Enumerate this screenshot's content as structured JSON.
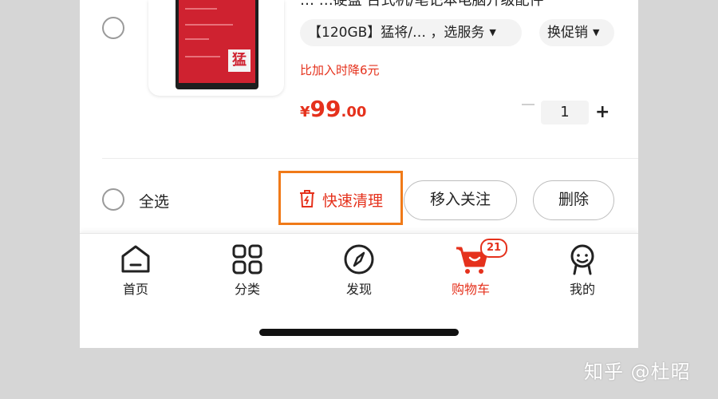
{
  "product": {
    "title_fragment": "… …硬盘 台式机/笔记本电脑升级配件",
    "variant_label": "【120GB】猛将/… ，选服务",
    "promo_selector_label": "换促销",
    "ssd_brand_mark": "猛",
    "price_notice": "比加入时降6元",
    "price_currency": "¥",
    "price_integer": "99",
    "price_decimal": ".00",
    "quantity": "1",
    "quantity_plus": "+"
  },
  "bottom_bar": {
    "select_all_label": "全选",
    "quick_clean_label": "快速清理",
    "move_to_favorites_label": "移入关注",
    "delete_label": "删除"
  },
  "tab_bar": {
    "tabs": [
      {
        "label": "首页",
        "icon": "home-icon"
      },
      {
        "label": "分类",
        "icon": "grid-icon"
      },
      {
        "label": "发现",
        "icon": "compass-icon"
      },
      {
        "label": "购物车",
        "icon": "cart-icon",
        "active": true,
        "badge": "21"
      },
      {
        "label": "我的",
        "icon": "profile-icon"
      }
    ]
  },
  "colors": {
    "accent": "#e5311c",
    "highlight_border": "#f07a18"
  },
  "watermark": "知乎 @杜昭"
}
